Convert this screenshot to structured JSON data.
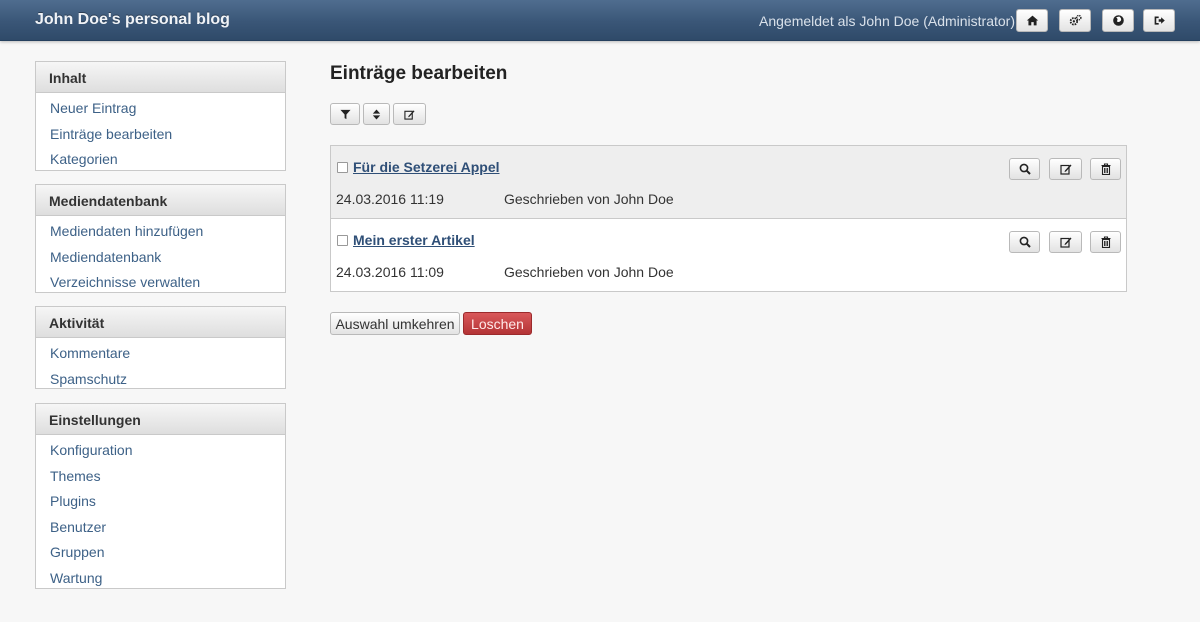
{
  "header": {
    "blog_title": "John Doe's personal blog",
    "login_text": "Angemeldet als John Doe (Administrator)",
    "icons": [
      "home-icon",
      "cogs-icon",
      "globe-icon",
      "logout-icon"
    ]
  },
  "sidebar": [
    {
      "title": "Inhalt",
      "items": [
        "Neuer Eintrag",
        "Einträge bearbeiten",
        "Kategorien"
      ]
    },
    {
      "title": "Mediendatenbank",
      "items": [
        "Mediendaten hinzufügen",
        "Mediendatenbank",
        "Verzeichnisse verwalten"
      ]
    },
    {
      "title": "Aktivität",
      "items": [
        "Kommentare",
        "Spamschutz"
      ]
    },
    {
      "title": "Einstellungen",
      "items": [
        "Konfiguration",
        "Themes",
        "Plugins",
        "Benutzer",
        "Gruppen",
        "Wartung"
      ]
    }
  ],
  "main": {
    "title": "Einträge bearbeiten",
    "toolbar_icons": [
      "filter-icon",
      "sort-icon",
      "edit-icon"
    ],
    "entries": [
      {
        "title": "Für die Setzerei Appel",
        "date": "24.03.2016 11:19",
        "author": "Geschrieben von John Doe"
      },
      {
        "title": "Mein erster Artikel",
        "date": "24.03.2016 11:09",
        "author": "Geschrieben von John Doe"
      }
    ],
    "invert_label": "Auswahl umkehren",
    "delete_label": "Loschen"
  },
  "colors": {
    "header": "#3a5677",
    "link": "#3d6187",
    "danger": "#c44446"
  }
}
